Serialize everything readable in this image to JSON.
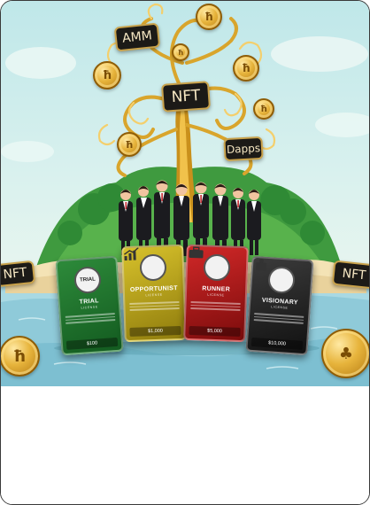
{
  "illustration": {
    "tags": {
      "amm": "AMM",
      "nft_center": "NFT",
      "dapps": "Dapps",
      "nft_left": "NFT",
      "nft_right": "NFT"
    },
    "cards": [
      {
        "title": "TRIAL",
        "subtitle": "LICENSE",
        "badge": "TRIAL",
        "price": "$100",
        "color": "#1f7a2e"
      },
      {
        "title": "OPPORTUNIST",
        "subtitle": "LICENSE",
        "badge": "",
        "price": "$1,000",
        "color": "#c2ab1c"
      },
      {
        "title": "RUNNER",
        "subtitle": "LICENSE",
        "badge": "",
        "price": "$5,000",
        "color": "#b91b1b"
      },
      {
        "title": "VISIONARY",
        "subtitle": "LICENSE",
        "badge": "",
        "price": "$10,000",
        "color": "#222222"
      }
    ],
    "colors": {
      "gold": "#d9a52c",
      "sky": "#c9ecec",
      "water": "#9fd3e0",
      "island": "#3f9a3f"
    }
  }
}
